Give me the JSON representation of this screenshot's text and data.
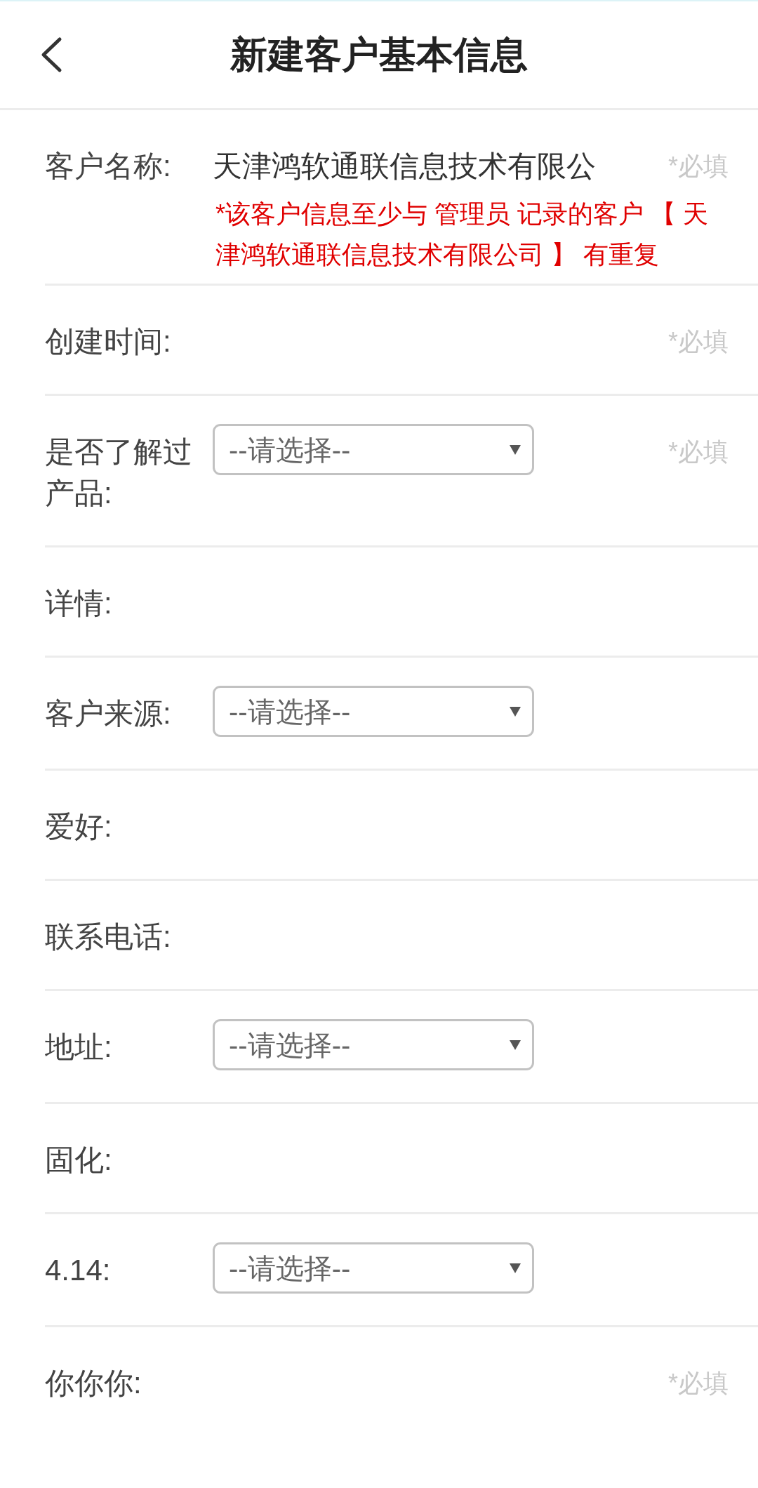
{
  "header": {
    "title": "新建客户基本信息"
  },
  "fields": [
    {
      "label": "客户名称:",
      "kind": "text",
      "value": "天津鸿软通联信息技术有限公",
      "required_mark": "*必填",
      "error": "*该客户信息至少与 管理员 记录的客户 【 天津鸿软通联信息技术有限公司 】 有重复"
    },
    {
      "label": "创建时间:",
      "kind": "text",
      "required_mark": "*必填"
    },
    {
      "label": "是否了解过产品:",
      "kind": "select",
      "placeholder": "--请选择--",
      "required_mark": "*必填"
    },
    {
      "label": "详情:",
      "kind": "text"
    },
    {
      "label": "客户来源:",
      "kind": "select",
      "placeholder": "--请选择--"
    },
    {
      "label": "爱好:",
      "kind": "text"
    },
    {
      "label": "联系电话:",
      "kind": "text"
    },
    {
      "label": "地址:",
      "kind": "select",
      "placeholder": "--请选择--"
    },
    {
      "label": "固化:",
      "kind": "text"
    },
    {
      "label": "4.14:",
      "kind": "select",
      "placeholder": "--请选择--"
    },
    {
      "label": "你你你:",
      "kind": "text",
      "required_mark": "*必填"
    }
  ]
}
